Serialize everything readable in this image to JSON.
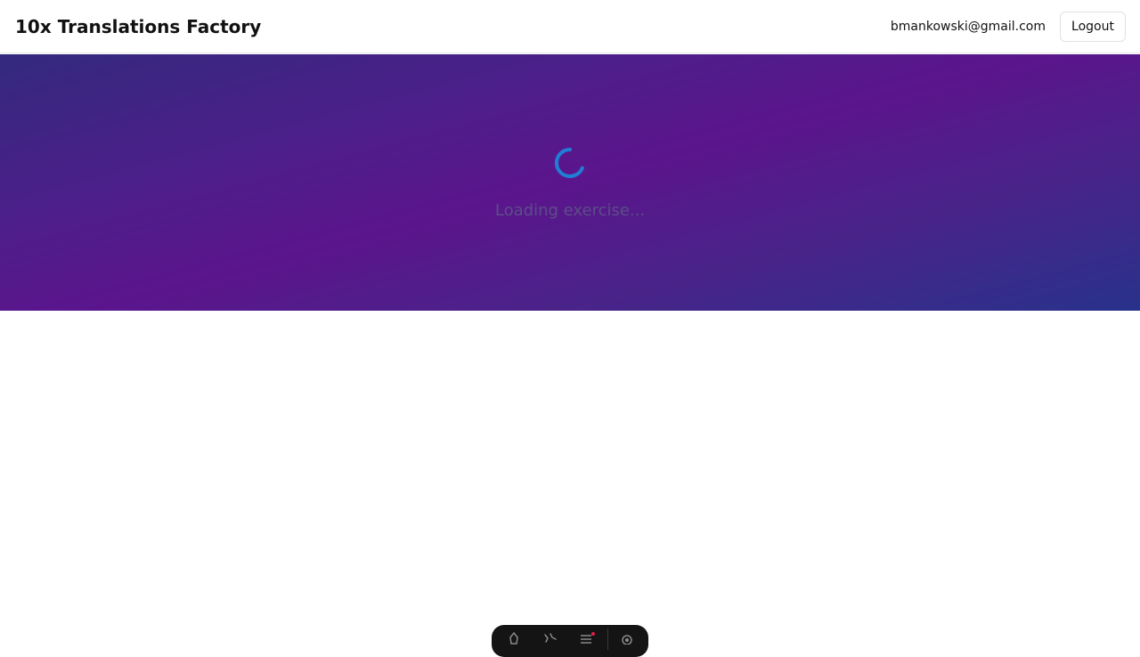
{
  "header": {
    "app_title": "10x Translations Factory",
    "user_email": "bmankowski@gmail.com",
    "logout_label": "Logout"
  },
  "main": {
    "loading_text": "Loading exercise...",
    "spinner_color": "#1f7fd6"
  },
  "dev_toolbar": {
    "icons": [
      "rocket-icon",
      "sparkle-icon",
      "menu-icon",
      "settings-icon"
    ],
    "notification_color": "#e11d48"
  },
  "colors": {
    "hero_gradient": [
      "#33297e",
      "#5b158c",
      "#28328a"
    ]
  }
}
